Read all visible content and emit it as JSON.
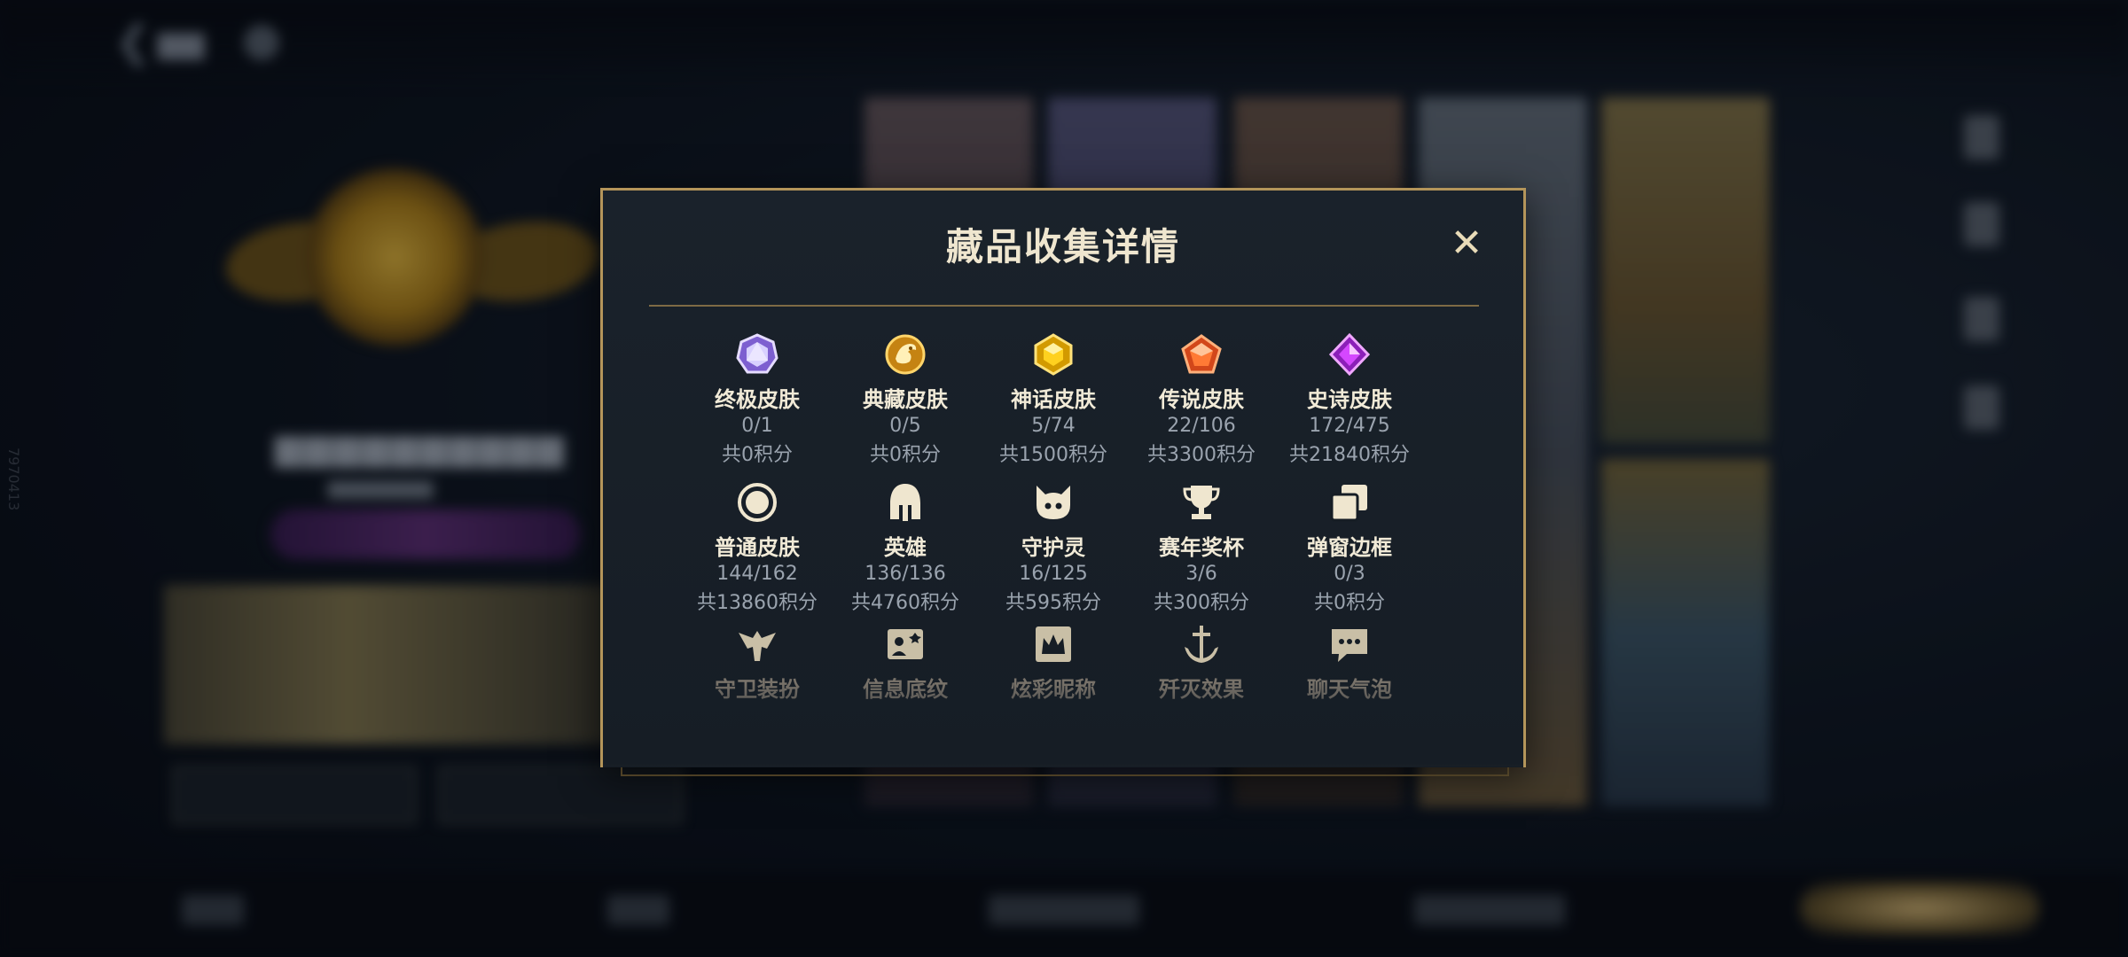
{
  "modal": {
    "title": "藏品收集详情",
    "close_glyph": "✕"
  },
  "categories": [
    {
      "name": "终极皮肤",
      "count": "0/1",
      "points": "共0积分",
      "icon": "ultimate-skin-gem-icon",
      "color": "#b9a8ff"
    },
    {
      "name": "典藏皮肤",
      "count": "0/5",
      "points": "共0积分",
      "icon": "collection-skin-dragon-icon",
      "color": "#e2a21c"
    },
    {
      "name": "神话皮肤",
      "count": "5/74",
      "points": "共1500积分",
      "icon": "mythic-skin-gem-icon",
      "color": "#f2c21b"
    },
    {
      "name": "传说皮肤",
      "count": "22/106",
      "points": "共3300积分",
      "icon": "legend-skin-gem-icon",
      "color": "#f06a22"
    },
    {
      "name": "史诗皮肤",
      "count": "172/475",
      "points": "共21840积分",
      "icon": "epic-skin-gem-icon",
      "color": "#c23be6"
    },
    {
      "name": "普通皮肤",
      "count": "144/162",
      "points": "共13860积分",
      "icon": "normal-skin-ring-icon",
      "color": "#eae3d0"
    },
    {
      "name": "英雄",
      "count": "136/136",
      "points": "共4760积分",
      "icon": "hero-helmet-icon",
      "color": "#eae3d0"
    },
    {
      "name": "守护灵",
      "count": "16/125",
      "points": "共595积分",
      "icon": "guardian-spirit-icon",
      "color": "#eae3d0"
    },
    {
      "name": "赛年奖杯",
      "count": "3/6",
      "points": "共300积分",
      "icon": "season-trophy-icon",
      "color": "#eae3d0"
    },
    {
      "name": "弹窗边框",
      "count": "0/3",
      "points": "共0积分",
      "icon": "popup-frame-icon",
      "color": "#eae3d0"
    },
    {
      "name": "守卫装扮",
      "count": "",
      "points": "",
      "icon": "guard-outfit-icon",
      "color": "#eae3d0"
    },
    {
      "name": "信息底纹",
      "count": "",
      "points": "",
      "icon": "info-background-icon",
      "color": "#eae3d0"
    },
    {
      "name": "炫彩昵称",
      "count": "",
      "points": "",
      "icon": "colorful-nickname-icon",
      "color": "#eae3d0"
    },
    {
      "name": "歼灭效果",
      "count": "",
      "points": "",
      "icon": "annihilation-effect-icon",
      "color": "#eae3d0"
    },
    {
      "name": "聊天气泡",
      "count": "",
      "points": "",
      "icon": "chat-bubble-icon",
      "color": "#eae3d0"
    }
  ],
  "background": {
    "side_tag": "7970413"
  },
  "colors": {
    "modal_border": "#b4955a",
    "title": "#efe6cf",
    "secondary_text": "#9aa3ae"
  }
}
